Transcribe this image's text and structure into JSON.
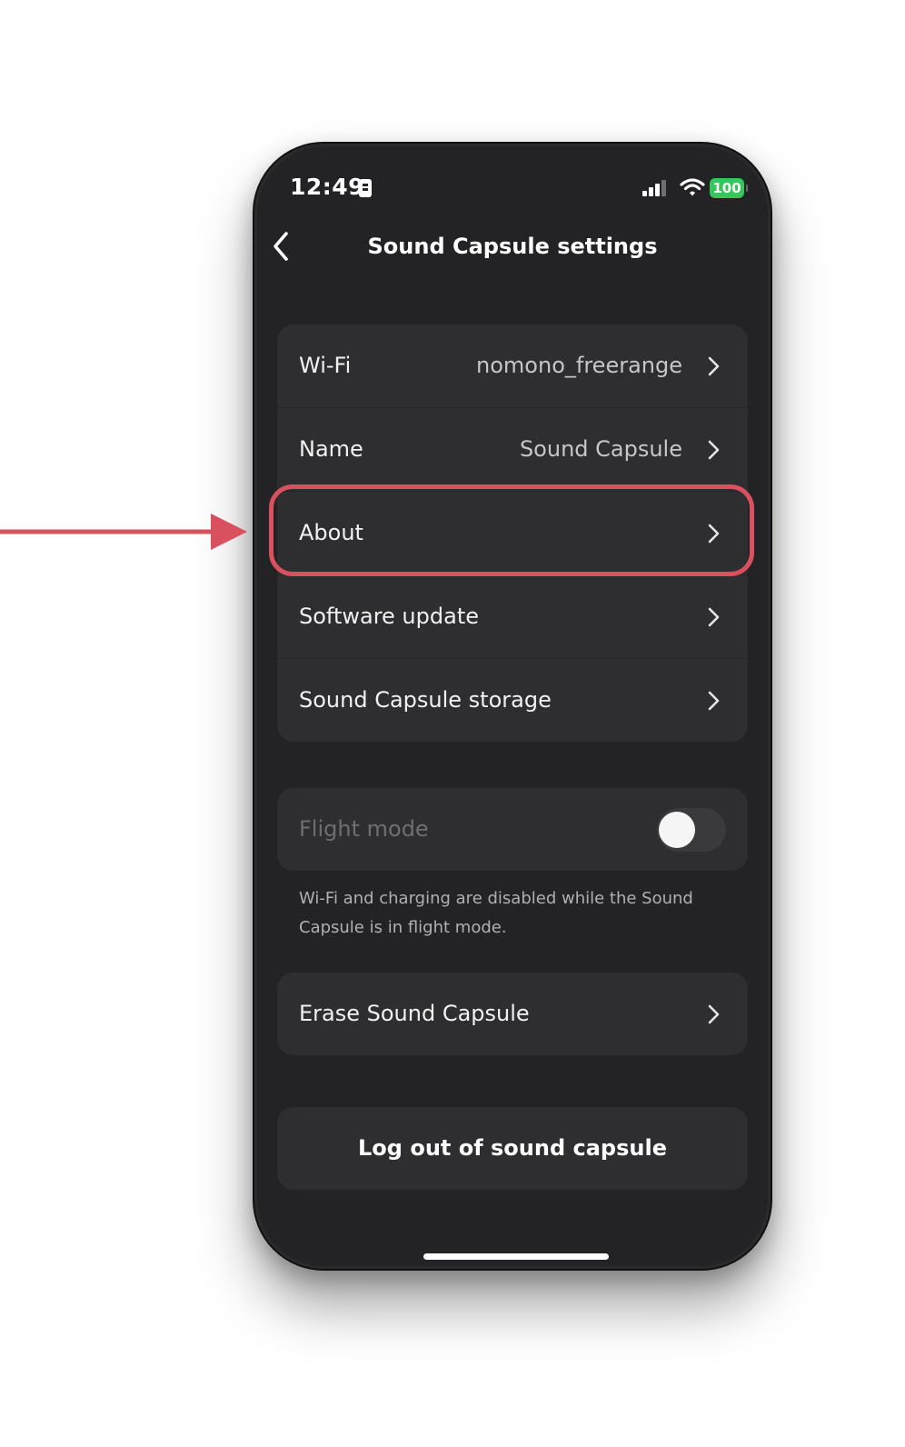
{
  "status_bar": {
    "time": "12:49",
    "battery": "100",
    "battery_color": "#34c759"
  },
  "nav": {
    "title": "Sound Capsule settings",
    "back_icon": "chevron-left-icon"
  },
  "settings": [
    {
      "label": "Wi-Fi",
      "value": "nomono_freerange"
    },
    {
      "label": "Name",
      "value": "Sound Capsule"
    },
    {
      "label": "About",
      "value": ""
    },
    {
      "label": "Software update",
      "value": ""
    },
    {
      "label": "Sound Capsule storage",
      "value": ""
    }
  ],
  "flight_mode": {
    "label": "Flight mode",
    "enabled": false,
    "note": "Wi-Fi and charging are disabled while the Sound Capsule is in flight mode."
  },
  "erase": {
    "label": "Erase Sound Capsule"
  },
  "logout": {
    "label": "Log out of sound capsule"
  },
  "annotation": {
    "highlight_color": "#d9505e"
  }
}
